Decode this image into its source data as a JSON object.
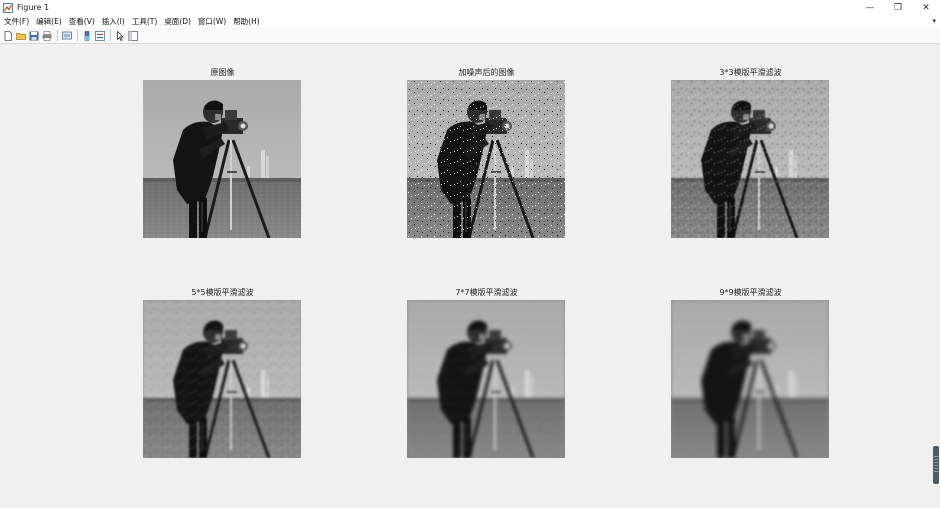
{
  "window": {
    "title": "Figure 1",
    "controls": {
      "minimize": "—",
      "restore": "❐",
      "close": "✕"
    }
  },
  "menu": {
    "items": [
      "文件(F)",
      "编辑(E)",
      "查看(V)",
      "插入(I)",
      "工具(T)",
      "桌面(D)",
      "窗口(W)",
      "帮助(H)"
    ],
    "overflow_arrow": "▾"
  },
  "toolbar": {
    "icons": [
      "new-figure-icon",
      "open-file-icon",
      "save-icon",
      "print-icon",
      "print-preview-icon",
      "colorbar-icon",
      "legend-icon",
      "pointer-icon",
      "property-editor-icon"
    ]
  },
  "panels": [
    {
      "title": "原图像",
      "variant": "original"
    },
    {
      "title": "加噪声后的图像",
      "variant": "noisy"
    },
    {
      "title": "3*3模版平滑滤波",
      "variant": "smooth3"
    },
    {
      "title": "5*5模版平滑滤波",
      "variant": "smooth5"
    },
    {
      "title": "7*7模版平滑滤波",
      "variant": "smooth7"
    },
    {
      "title": "9*9模版平滑滤波",
      "variant": "smooth9"
    }
  ]
}
